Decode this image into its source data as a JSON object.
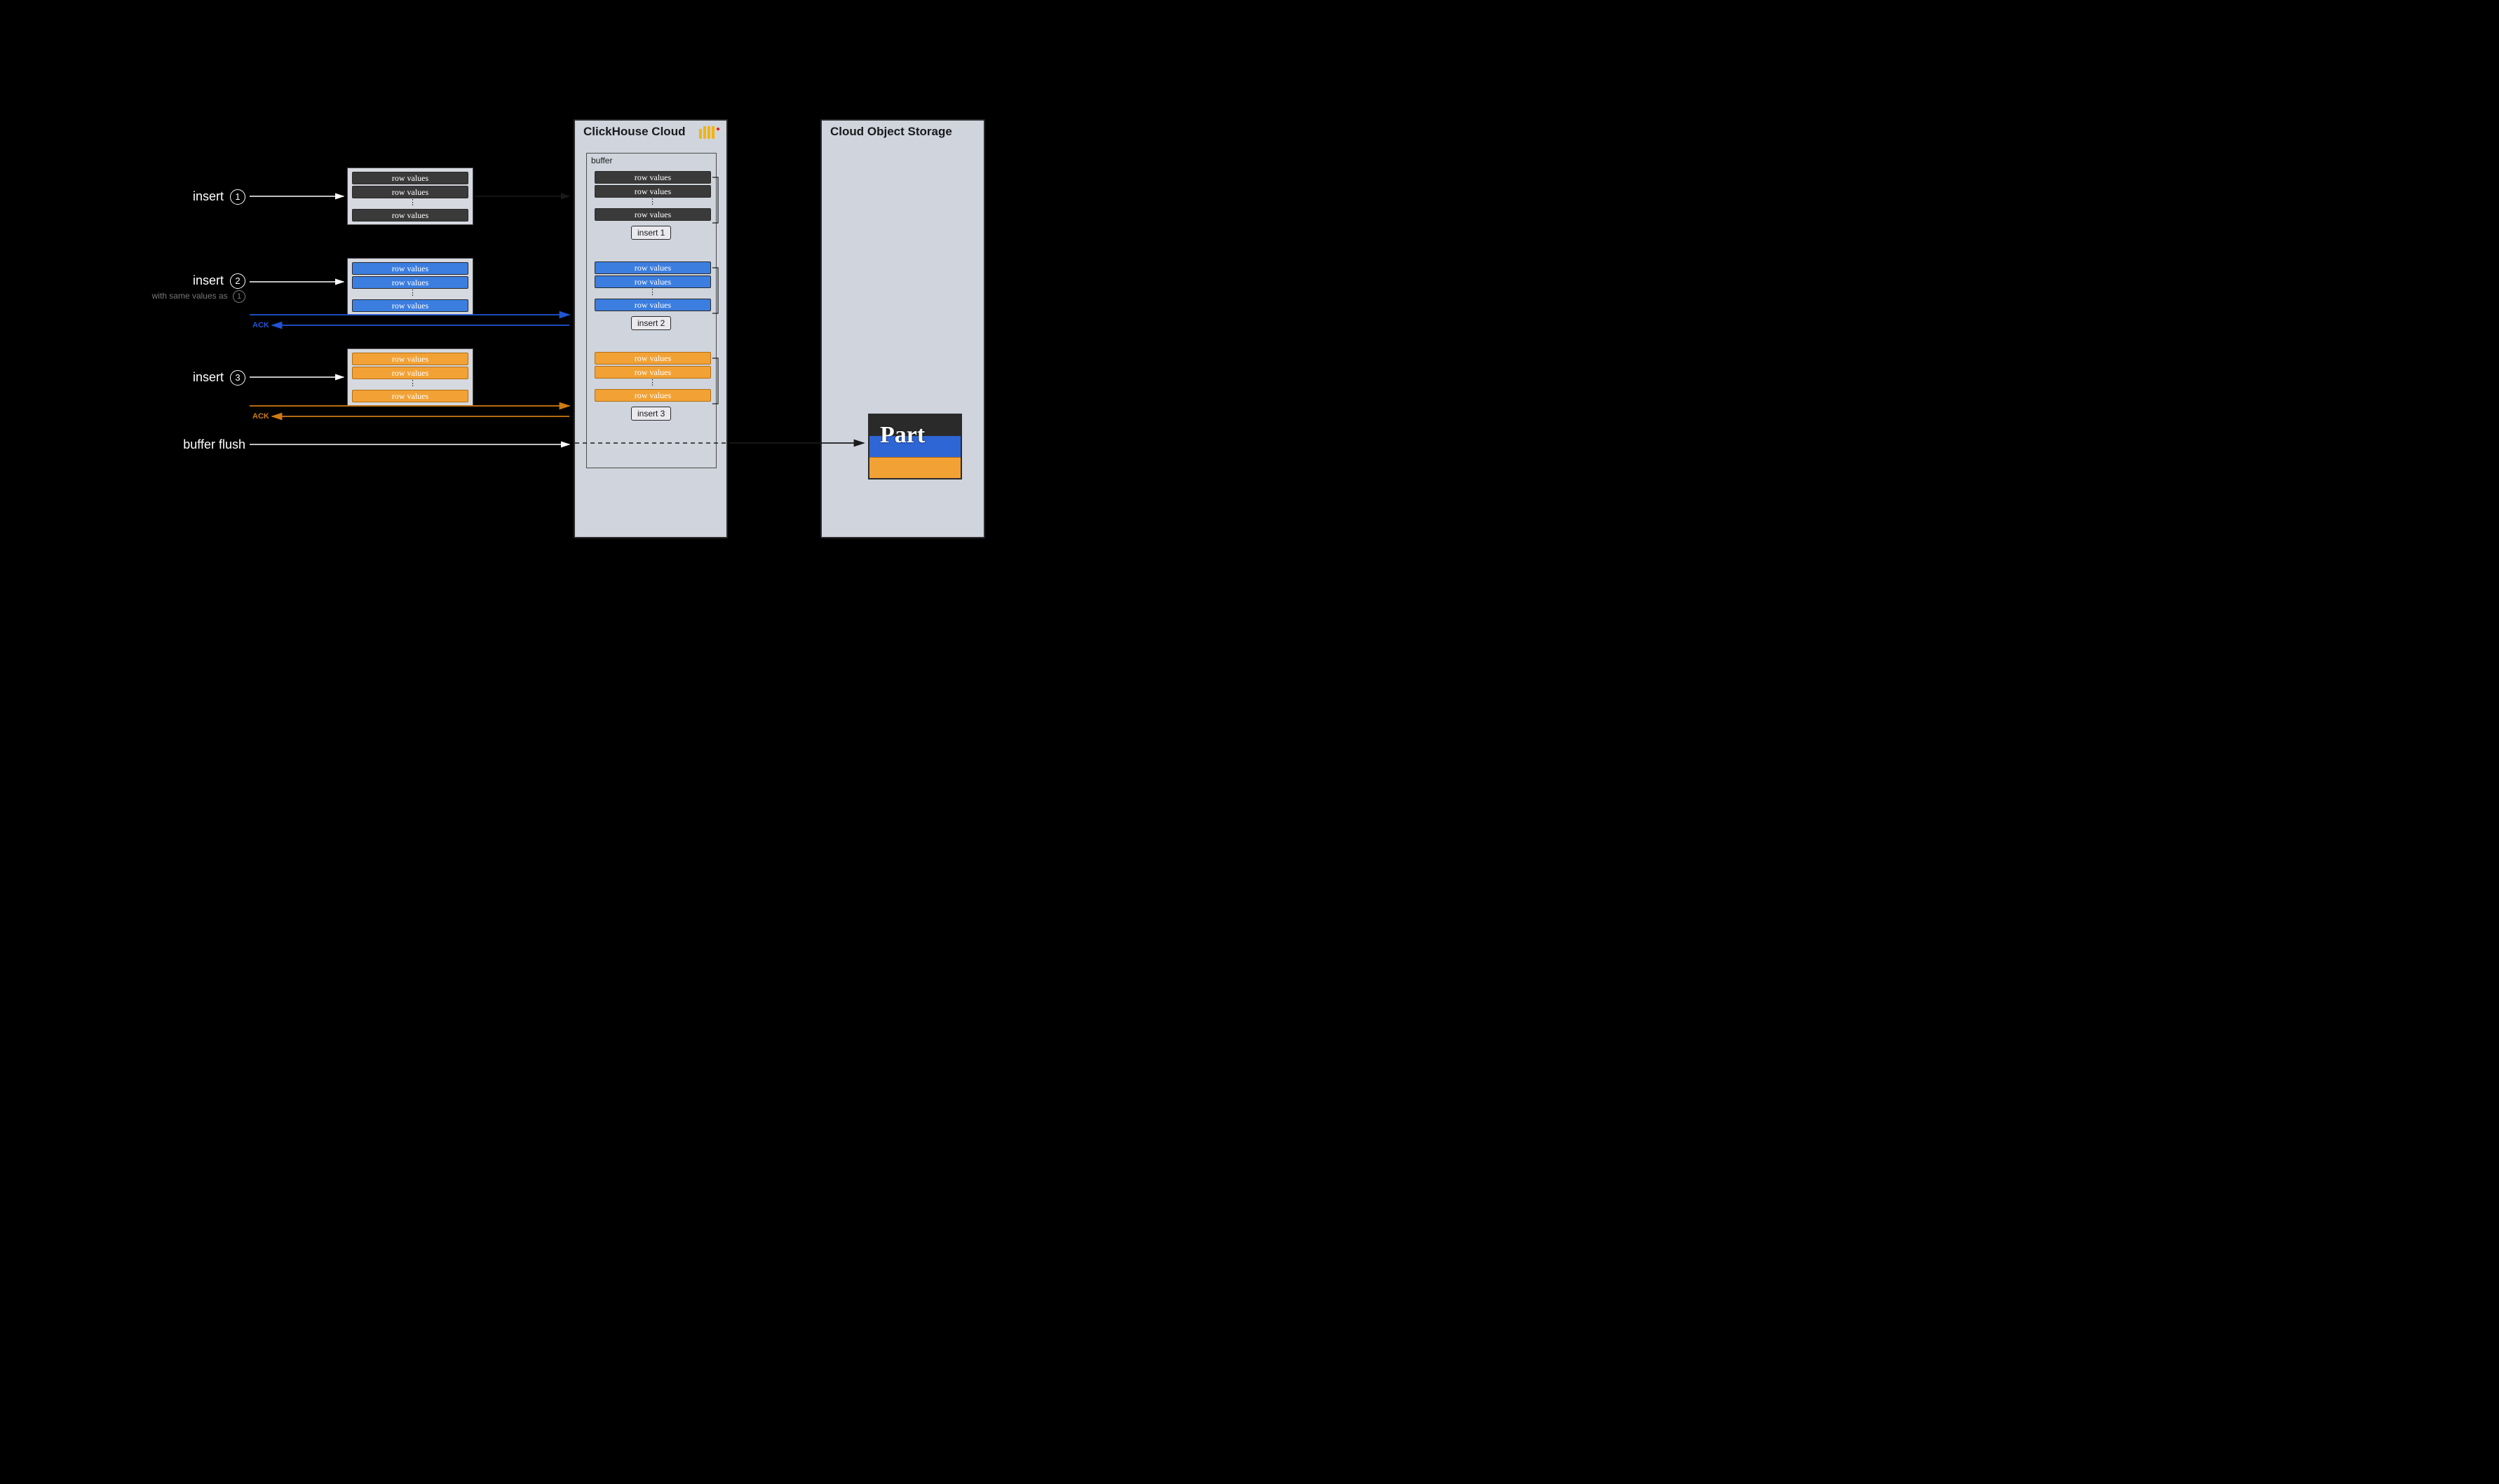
{
  "panels": {
    "clickhouse": {
      "title": "ClickHouse Cloud"
    },
    "storage": {
      "title": "Cloud Object Storage"
    }
  },
  "buffer": {
    "label": "buffer"
  },
  "row_label": "row values",
  "part_label": "Part",
  "ack_label": "ACK",
  "left_labels": {
    "l1": {
      "main": "insert",
      "num": "1"
    },
    "l2": {
      "main": "insert",
      "num": "2",
      "sub": "with same values as"
    },
    "l3": {
      "main": "insert",
      "num": "3"
    },
    "l4": {
      "main": "buffer flush"
    }
  },
  "insert_badges": {
    "b1": "insert 1",
    "b2": "insert 2",
    "b3": "insert 3"
  },
  "arrows": {
    "colors": {
      "blue": "#2054d4",
      "orange": "#cf7b12",
      "black": "#1a1a1a"
    }
  }
}
